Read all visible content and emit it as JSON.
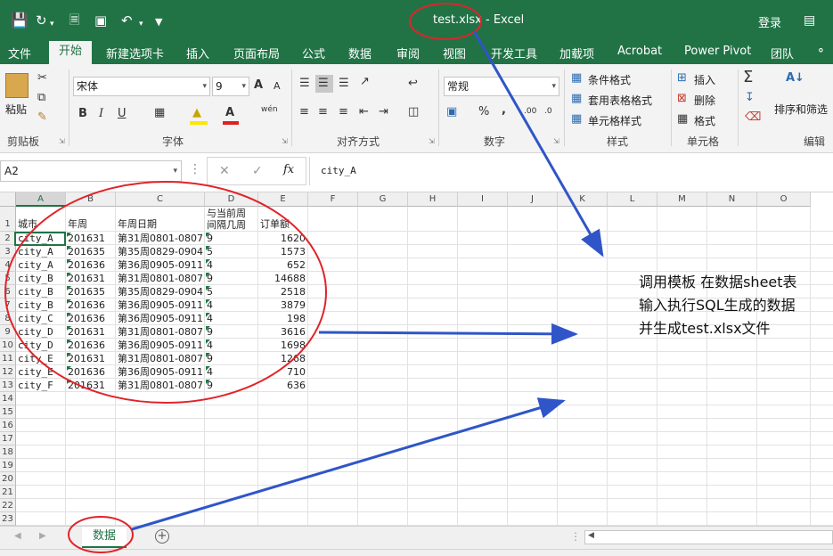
{
  "titlebar": {
    "doc_title": "test.xlsx - Excel",
    "login": "登录",
    "save_icon": "save-icon",
    "undo_icon": "undo-icon",
    "redo_icon": "redo-icon"
  },
  "tabs": [
    "文件",
    "开始",
    "新建选项卡",
    "插入",
    "页面布局",
    "公式",
    "数据",
    "审阅",
    "视图",
    "开发工具",
    "加载项",
    "Acrobat",
    "Power Pivot",
    "团队"
  ],
  "ribbon": {
    "clipboard": {
      "paste": "粘贴",
      "group": "剪贴板"
    },
    "font": {
      "name": "宋体",
      "size": "9",
      "group": "字体",
      "bold": "B",
      "italic": "I",
      "underline": "U",
      "grow": "A",
      "shrink": "A",
      "phonetic": "wén"
    },
    "alignment": {
      "group": "对齐方式"
    },
    "number": {
      "format": "常规",
      "percent": "%",
      "comma": ",",
      "group": "数字"
    },
    "styles": {
      "conditional": "条件格式",
      "table": "套用表格格式",
      "cell": "单元格样式",
      "group": "样式"
    },
    "cells": {
      "insert": "插入",
      "delete": "删除",
      "format": "格式",
      "group": "单元格"
    },
    "editing": {
      "sort": "排序和筛选",
      "sum": "Σ",
      "group": "编辑"
    }
  },
  "formula_bar": {
    "name_box": "A2",
    "cancel": "✕",
    "confirm": "✓",
    "fx": "fx",
    "value": "city_A"
  },
  "columns": [
    "A",
    "B",
    "C",
    "D",
    "E",
    "F",
    "G",
    "H",
    "I",
    "J",
    "K",
    "L",
    "M",
    "N",
    "O"
  ],
  "rows": [
    "1",
    "2",
    "3",
    "4",
    "5",
    "6",
    "7",
    "8",
    "9",
    "10",
    "11",
    "12",
    "13",
    "14",
    "15",
    "16",
    "17",
    "18",
    "19",
    "20",
    "21",
    "22",
    "23"
  ],
  "table": {
    "headers": [
      "城市",
      "年周",
      "年周日期",
      "与当前周",
      "间隔几周",
      "订单额"
    ],
    "data": [
      [
        "city_A",
        "201631",
        "第31周0801-0807",
        "9",
        "1620"
      ],
      [
        "city_A",
        "201635",
        "第35周0829-0904",
        "5",
        "1573"
      ],
      [
        "city_A",
        "201636",
        "第36周0905-0911",
        "4",
        "652"
      ],
      [
        "city_B",
        "201631",
        "第31周0801-0807",
        "9",
        "14688"
      ],
      [
        "city_B",
        "201635",
        "第35周0829-0904",
        "5",
        "2518"
      ],
      [
        "city_B",
        "201636",
        "第36周0905-0911",
        "4",
        "3879"
      ],
      [
        "city_C",
        "201636",
        "第36周0905-0911",
        "4",
        "198"
      ],
      [
        "city_D",
        "201631",
        "第31周0801-0807",
        "9",
        "3616"
      ],
      [
        "city_D",
        "201636",
        "第36周0905-0911",
        "4",
        "1698"
      ],
      [
        "city_E",
        "201631",
        "第31周0801-0807",
        "9",
        "1268"
      ],
      [
        "city_E",
        "201636",
        "第36周0905-0911",
        "4",
        "710"
      ],
      [
        "city_F",
        "201631",
        "第31周0801-0807",
        "9",
        "636"
      ]
    ]
  },
  "sheet_tabs": {
    "active": "数据",
    "add": "+"
  },
  "annotation": {
    "line1": "调用模板 在数据sheet表",
    "line2": "输入执行SQL生成的数据",
    "line3": "并生成test.xlsx文件"
  },
  "colors": {
    "excel_green": "#217346",
    "annotation_red": "#e0242a",
    "arrow_blue": "#2f55c8"
  }
}
